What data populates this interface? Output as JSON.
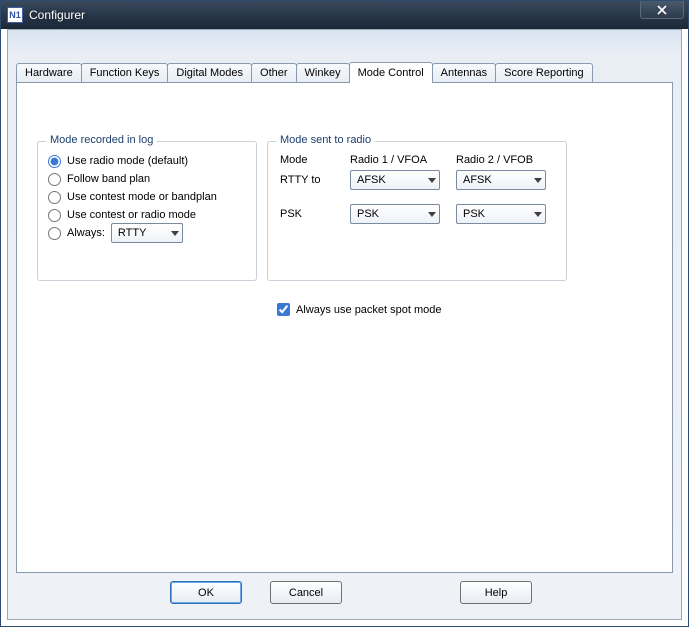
{
  "window": {
    "title": "Configurer",
    "icon_label": "N1"
  },
  "tabs": [
    {
      "label": "Hardware"
    },
    {
      "label": "Function Keys"
    },
    {
      "label": "Digital Modes"
    },
    {
      "label": "Other"
    },
    {
      "label": "Winkey"
    },
    {
      "label": "Mode Control"
    },
    {
      "label": "Antennas"
    },
    {
      "label": "Score Reporting"
    }
  ],
  "active_tab_index": 5,
  "group_log": {
    "legend": "Mode recorded in log",
    "options": [
      "Use radio mode (default)",
      "Follow band plan",
      "Use contest mode or bandplan",
      "Use contest or radio mode",
      "Always:"
    ],
    "selected_index": 0,
    "always_value": "RTTY"
  },
  "group_radio": {
    "legend": "Mode sent to radio",
    "labels": {
      "mode": "Mode",
      "radio1": "Radio 1 / VFOA",
      "radio2": "Radio 2 / VFOB",
      "rtty": "RTTY  to",
      "psk": "PSK"
    },
    "values": {
      "rtty_r1": "AFSK",
      "rtty_r2": "AFSK",
      "psk_r1": "PSK",
      "psk_r2": "PSK"
    }
  },
  "checkbox": {
    "label": "Always use packet spot mode",
    "checked": true
  },
  "buttons": {
    "ok": "OK",
    "cancel": "Cancel",
    "help": "Help"
  }
}
